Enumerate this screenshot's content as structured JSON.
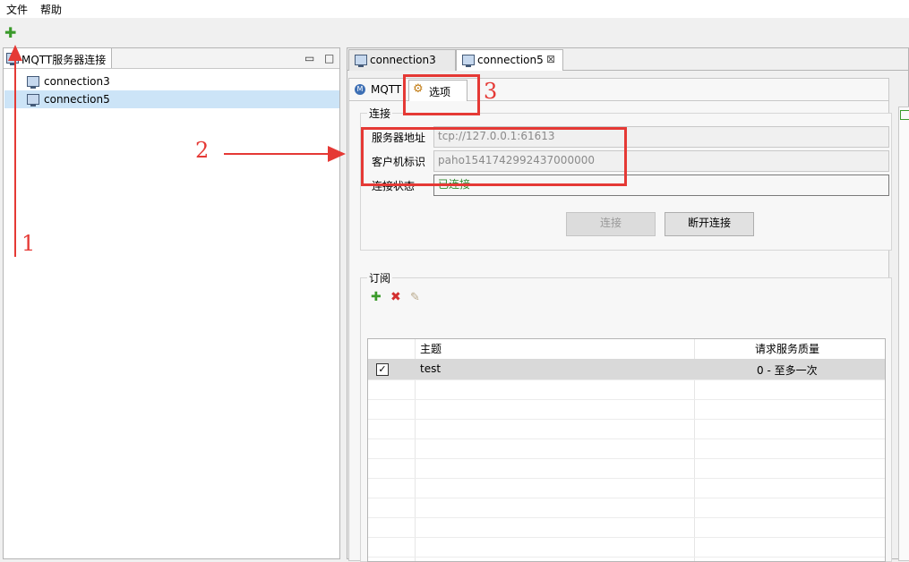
{
  "menu": {
    "file": "文件",
    "help": "帮助"
  },
  "toolbar": {
    "add_icon": "plus-icon"
  },
  "left_view": {
    "title": "MQTT服务器连接",
    "items": [
      {
        "label": "connection3",
        "selected": false
      },
      {
        "label": "connection5",
        "selected": true
      }
    ]
  },
  "editor": {
    "tabs": [
      {
        "label": "connection3",
        "active": false
      },
      {
        "label": "connection5",
        "active": true,
        "close": "⊠"
      }
    ],
    "subtabs": [
      {
        "label": "MQTT",
        "icon": "mqtt-icon"
      },
      {
        "label": "选项",
        "icon": "gear-icon"
      }
    ],
    "connection": {
      "group_label": "连接",
      "server_label": "服务器地址",
      "server_value": "tcp://127.0.0.1:61613",
      "client_label": "客户机标识",
      "client_value": "paho1541742992437000000",
      "status_label": "连接状态",
      "status_value": "已连接",
      "status_color": "#2e8b2e",
      "connect_button": "连接",
      "disconnect_button": "断开连接"
    },
    "subscription": {
      "group_label": "订阅",
      "columns": [
        "主题",
        "请求服务质量"
      ],
      "rows": [
        {
          "checked": true,
          "topic": "test",
          "qos": "0 - 至多一次"
        }
      ]
    }
  },
  "annotations": {
    "one": "1",
    "two": "2",
    "three": "3",
    "color": "#e53935"
  }
}
